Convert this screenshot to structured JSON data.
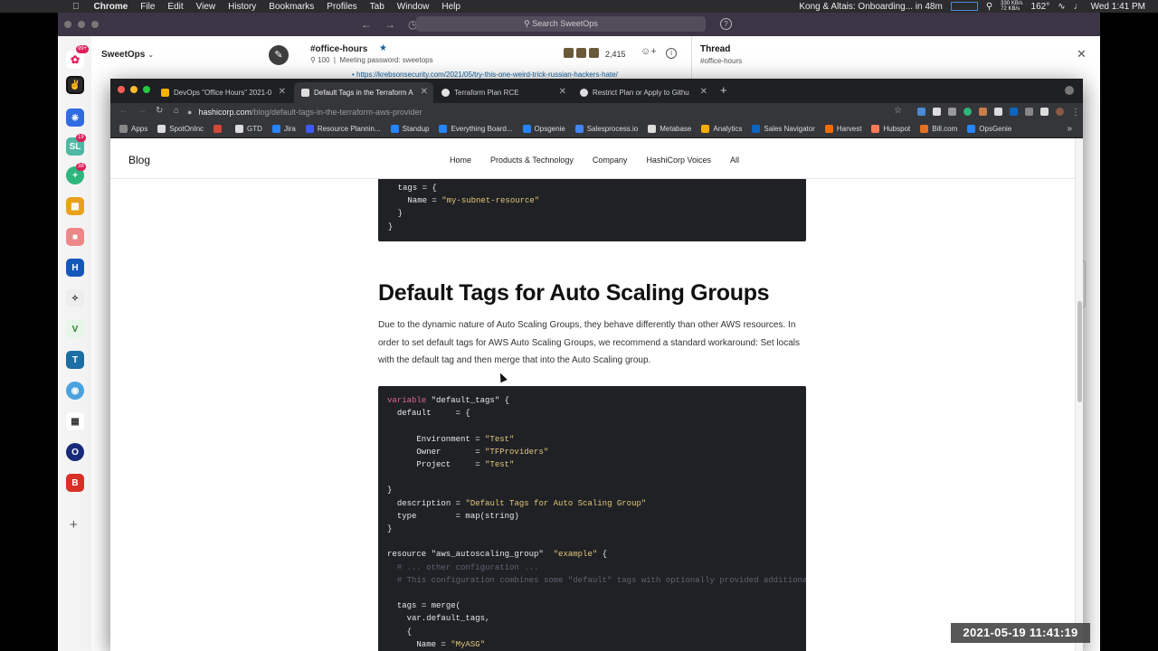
{
  "mac_menubar": {
    "app_name": "Chrome",
    "items": [
      "File",
      "Edit",
      "View",
      "History",
      "Bookmarks",
      "Profiles",
      "Tab",
      "Window",
      "Help"
    ],
    "event": "Kong & Altais: Onboarding... in 48m",
    "net_up": "330 KB/s",
    "net_down": "72 KB/s",
    "temp": "162°",
    "clock": "Wed 1:41 PM"
  },
  "slack": {
    "search_placeholder": "Search SweetOps",
    "workspace": "SweetOps",
    "rail_badges": [
      "99+",
      "19",
      "38"
    ],
    "channel": {
      "name": "#office-hours",
      "members_short": "100",
      "topic": "Meeting password: sweetops",
      "member_count": "2,415",
      "link_preview": "https://krebsonsecurity.com/2021/05/try-this-one-weird-trick-russian-hackers-hate/"
    },
    "thread": {
      "title": "Thread",
      "channel": "#office-hours"
    }
  },
  "browser": {
    "tabs": [
      {
        "label": "DevOps \"Office Hours\" 2021-0",
        "fav_color": "#f4b400",
        "active": false
      },
      {
        "label": "Default Tags in the Terraform A",
        "fav_color": "#dddddd",
        "active": true
      },
      {
        "label": "Terraform Plan RCE",
        "fav_color": "#e3e3e3",
        "active": false
      },
      {
        "label": "Restrict Plan or Apply to Githu",
        "fav_color": "#dddddd",
        "active": false
      }
    ],
    "url_host": "hashicorp.com",
    "url_path": "/blog/default-tags-in-the-terraform-aws-provider",
    "bookmarks": [
      {
        "label": "Apps",
        "color": "#888888"
      },
      {
        "label": "SpotOnInc",
        "color": "#dddddd"
      },
      {
        "label": "",
        "color": "#d44638"
      },
      {
        "label": "GTD",
        "color": "#dddddd"
      },
      {
        "label": "Jira",
        "color": "#2684ff"
      },
      {
        "label": "Resource Plannin...",
        "color": "#3d5afe"
      },
      {
        "label": "Standup",
        "color": "#2684ff"
      },
      {
        "label": "Everything Board...",
        "color": "#2684ff"
      },
      {
        "label": "Opsgenie",
        "color": "#2684ff"
      },
      {
        "label": "Salesprocess.io",
        "color": "#4285f4"
      },
      {
        "label": "Metabase",
        "color": "#dddddd"
      },
      {
        "label": "Analytics",
        "color": "#f9ab00"
      },
      {
        "label": "Sales Navigator",
        "color": "#0a66c2"
      },
      {
        "label": "Harvest",
        "color": "#f36c00"
      },
      {
        "label": "Hubspot",
        "color": "#ff7a59"
      },
      {
        "label": "Bill.com",
        "color": "#e37222"
      },
      {
        "label": "OpsGenie",
        "color": "#2684ff"
      }
    ]
  },
  "site": {
    "logo": "Blog",
    "nav": [
      "Home",
      "Products & Technology",
      "Company",
      "HashiCorp Voices",
      "All"
    ]
  },
  "article": {
    "code_top": [
      {
        "indent": 1,
        "parts": [
          {
            "t": "tags = {",
            "c": ""
          }
        ]
      },
      {
        "indent": 2,
        "parts": [
          {
            "t": "Name = ",
            "c": ""
          },
          {
            "t": "\"my-subnet-resource\"",
            "c": "str"
          }
        ]
      },
      {
        "indent": 1,
        "parts": [
          {
            "t": "}",
            "c": ""
          }
        ]
      },
      {
        "indent": 0,
        "parts": [
          {
            "t": "}",
            "c": ""
          }
        ]
      }
    ],
    "heading": "Default Tags for Auto Scaling Groups",
    "paragraph": "Due to the dynamic nature of Auto Scaling Groups, they behave differently than other AWS resources. In order to set default tags for AWS Auto Scaling Groups, we recommend a standard workaround: Set locals with the default tag and then merge that into the Auto Scaling group.",
    "code_main": [
      {
        "indent": 0,
        "parts": [
          {
            "t": "variable",
            "c": "kw"
          },
          {
            "t": " \"default_tags\" {",
            "c": ""
          }
        ]
      },
      {
        "indent": 1,
        "parts": [
          {
            "t": "default     = {",
            "c": ""
          }
        ]
      },
      {
        "indent": 0,
        "parts": []
      },
      {
        "indent": 3,
        "parts": [
          {
            "t": "Environment = ",
            "c": ""
          },
          {
            "t": "\"Test\"",
            "c": "str"
          }
        ]
      },
      {
        "indent": 3,
        "parts": [
          {
            "t": "Owner       = ",
            "c": ""
          },
          {
            "t": "\"TFProviders\"",
            "c": "str"
          }
        ]
      },
      {
        "indent": 3,
        "parts": [
          {
            "t": "Project     = ",
            "c": ""
          },
          {
            "t": "\"Test\"",
            "c": "str"
          }
        ]
      },
      {
        "indent": 0,
        "parts": []
      },
      {
        "indent": 0,
        "parts": [
          {
            "t": "}",
            "c": ""
          }
        ]
      },
      {
        "indent": 1,
        "parts": [
          {
            "t": "description = ",
            "c": ""
          },
          {
            "t": "\"Default Tags for Auto Scaling Group\"",
            "c": "str"
          }
        ]
      },
      {
        "indent": 1,
        "parts": [
          {
            "t": "type        = map(string)",
            "c": ""
          }
        ]
      },
      {
        "indent": 0,
        "parts": [
          {
            "t": "}",
            "c": ""
          }
        ]
      },
      {
        "indent": 0,
        "parts": []
      },
      {
        "indent": 0,
        "parts": [
          {
            "t": "resource \"aws_autoscaling_group\"  ",
            "c": ""
          },
          {
            "t": "\"example\"",
            "c": "str"
          },
          {
            "t": " {",
            "c": ""
          }
        ]
      },
      {
        "indent": 1,
        "parts": [
          {
            "t": "# ... other configuration ...",
            "c": "cm"
          }
        ]
      },
      {
        "indent": 1,
        "parts": [
          {
            "t": "# This configuration combines some \"default\" tags with optionally provided additional",
            "c": "cm"
          }
        ]
      },
      {
        "indent": 0,
        "parts": []
      },
      {
        "indent": 1,
        "parts": [
          {
            "t": "tags = merge(",
            "c": ""
          }
        ]
      },
      {
        "indent": 2,
        "parts": [
          {
            "t": "var.default_tags,",
            "c": ""
          }
        ]
      },
      {
        "indent": 2,
        "parts": [
          {
            "t": "{",
            "c": ""
          }
        ]
      },
      {
        "indent": 3,
        "parts": [
          {
            "t": "Name = ",
            "c": ""
          },
          {
            "t": "\"MyASG\"",
            "c": "str"
          }
        ]
      }
    ]
  },
  "video_timestamp": "2021-05-19  11:41:19"
}
